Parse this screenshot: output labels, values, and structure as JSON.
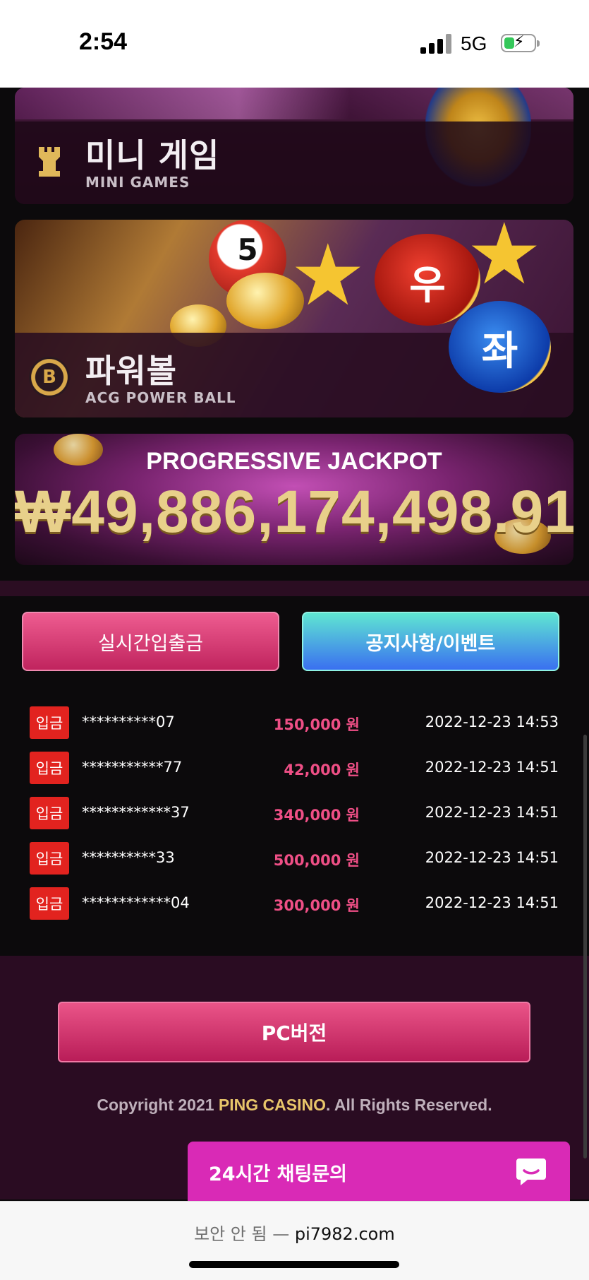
{
  "status_bar": {
    "time": "2:54",
    "network": "5G",
    "battery_icon": "battery-charging-icon"
  },
  "banners": {
    "mini_games": {
      "title": "미니 게임",
      "subtitle": "MINI GAMES",
      "icon": "rook-icon"
    },
    "power_ball": {
      "title": "파워볼",
      "subtitle": "ACG POWER BALL",
      "icon": "b-coin-icon",
      "ball_number": "5",
      "ball_red": "우",
      "ball_blue": "좌"
    },
    "jackpot": {
      "title": "PROGRESSIVE JACKPOT",
      "amount": "₩49,886,174,498.91"
    }
  },
  "actions": {
    "live_transactions": "실시간입출금",
    "notice_events": "공지사항/이벤트"
  },
  "transactions": [
    {
      "type": "입금",
      "user": "**********07",
      "amount": "150,000 원",
      "time": "2022-12-23 14:53"
    },
    {
      "type": "입금",
      "user": "***********77",
      "amount": "42,000 원",
      "time": "2022-12-23 14:51"
    },
    {
      "type": "입금",
      "user": "************37",
      "amount": "340,000 원",
      "time": "2022-12-23 14:51"
    },
    {
      "type": "입금",
      "user": "**********33",
      "amount": "500,000 원",
      "time": "2022-12-23 14:51"
    },
    {
      "type": "입금",
      "user": "************04",
      "amount": "300,000 원",
      "time": "2022-12-23 14:51"
    }
  ],
  "footer": {
    "pc_button": "PC버전",
    "copyright_prefix": "Copyright 2021 ",
    "copyright_brand": "PING CASINO",
    "copyright_suffix": ". All Rights Reserved."
  },
  "chat": {
    "label": "24시간 채팅문의",
    "icon": "chat-bubble-icon"
  },
  "browser": {
    "security": "보안 안 됨 — ",
    "domain": "pi7982.com"
  },
  "colors": {
    "accent_pink": "#ef4f86",
    "badge_red": "#e2231f",
    "chat_magenta": "#d92ab6",
    "gold": "#e8c56a"
  }
}
